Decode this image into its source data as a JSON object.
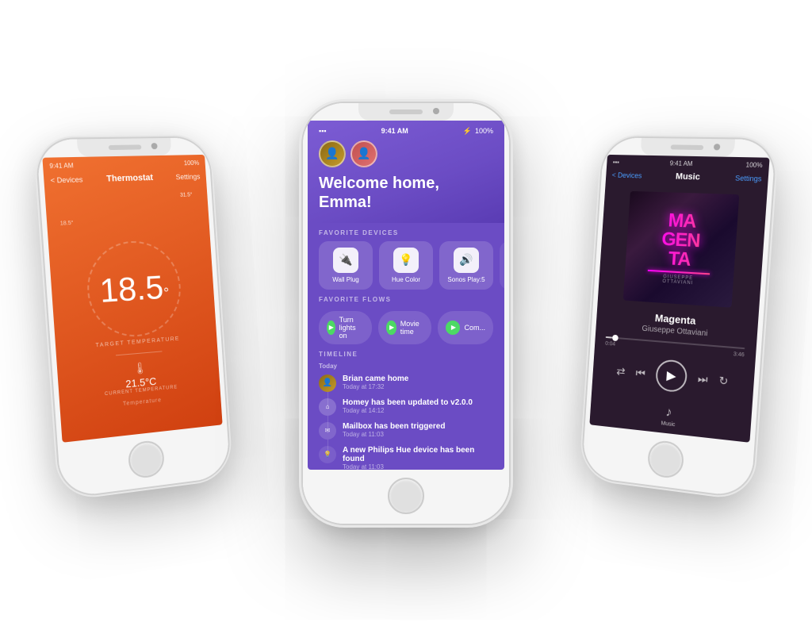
{
  "phones": {
    "left": {
      "title": "Thermostat",
      "nav_back": "< Devices",
      "nav_settings": "Settings",
      "status_time": "9:41 AM",
      "status_battery": "100%",
      "target_temp": "18.5°",
      "target_temp_label": "TARGET TEMPERATURE",
      "current_temp": "21.5°C",
      "current_temp_label": "CURRENT TEMPERATURE",
      "bottom_label": "Temperature",
      "dial_high": "31.5°",
      "dial_low": "18.5°"
    },
    "center": {
      "status_time": "9:41 AM",
      "status_bluetooth": "BT",
      "status_battery": "100%",
      "welcome_text": "Welcome home, Emma!",
      "section_favorites": "FAVORITE DEVICES",
      "section_flows": "FAVORITE FLOWS",
      "section_timeline": "TIMELINE",
      "devices": [
        {
          "label": "Wall Plug",
          "icon": "🔌"
        },
        {
          "label": "Hue Color",
          "icon": "💡"
        },
        {
          "label": "Sonos Play:5",
          "icon": "🔊"
        }
      ],
      "flows": [
        {
          "label": "Turn lights on"
        },
        {
          "label": "Movie time"
        },
        {
          "label": "Com..."
        }
      ],
      "timeline_day": "Today",
      "timeline_items": [
        {
          "type": "brian",
          "title": "Brian came home",
          "time": "Today at 17:32"
        },
        {
          "type": "homey",
          "title": "Homey has been updated to v2.0.0",
          "time": "Today at 14:12"
        },
        {
          "type": "mailbox",
          "title": "Mailbox has been triggered",
          "time": "Today at 11:03"
        },
        {
          "type": "philips",
          "title": "A new Philips Hue device has been found",
          "time": "Today at 11:03"
        }
      ]
    },
    "right": {
      "nav_back": "< Devices",
      "nav_title": "Music",
      "nav_settings": "Settings",
      "status_time": "9:41 AM",
      "status_battery": "100%",
      "album_name": "MAGENTA",
      "album_artist_small": "GIUSEPPE OTTAVIANI",
      "song_title": "Magenta",
      "song_artist": "Giuseppe Ottaviani",
      "time_current": "0:04",
      "time_total": "3:46",
      "tab_label": "Music"
    }
  }
}
